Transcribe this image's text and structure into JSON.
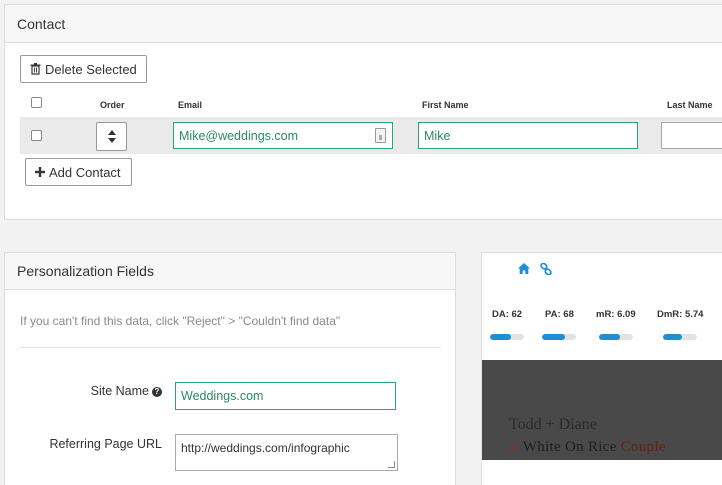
{
  "contact": {
    "title": "Contact",
    "delete_label": "Delete Selected",
    "add_label": "Add Contact",
    "columns": {
      "order": "Order",
      "email": "Email",
      "first_name": "First Name",
      "last_name": "Last Name"
    },
    "row": {
      "email": "Mike@weddings.com",
      "first_name": "Mike",
      "last_name": ""
    }
  },
  "personalization": {
    "title": "Personalization Fields",
    "hint": "If you can't find this data, click \"Reject\" > \"Couldn't find data\"",
    "site_name_label": "Site Name",
    "site_name_value": "Weddings.com",
    "referring_label": "Referring Page URL",
    "referring_value": "http://weddings.com/infographic"
  },
  "seo": {
    "metrics": [
      {
        "label": "DA: 62",
        "fraction": 0.62
      },
      {
        "label": "PA: 68",
        "fraction": 0.68
      },
      {
        "label": "mR: 6.09",
        "fraction": 0.61
      },
      {
        "label": "DmR: 5.74",
        "fraction": 0.57
      }
    ],
    "preview_line1": "Todd + Diane",
    "preview_chevron": "»",
    "preview_brand_main": "White On Rice ",
    "preview_brand_accent": "Couple",
    "accent_color": "#1e8fd6",
    "field_border_color": "#2aa57a"
  }
}
